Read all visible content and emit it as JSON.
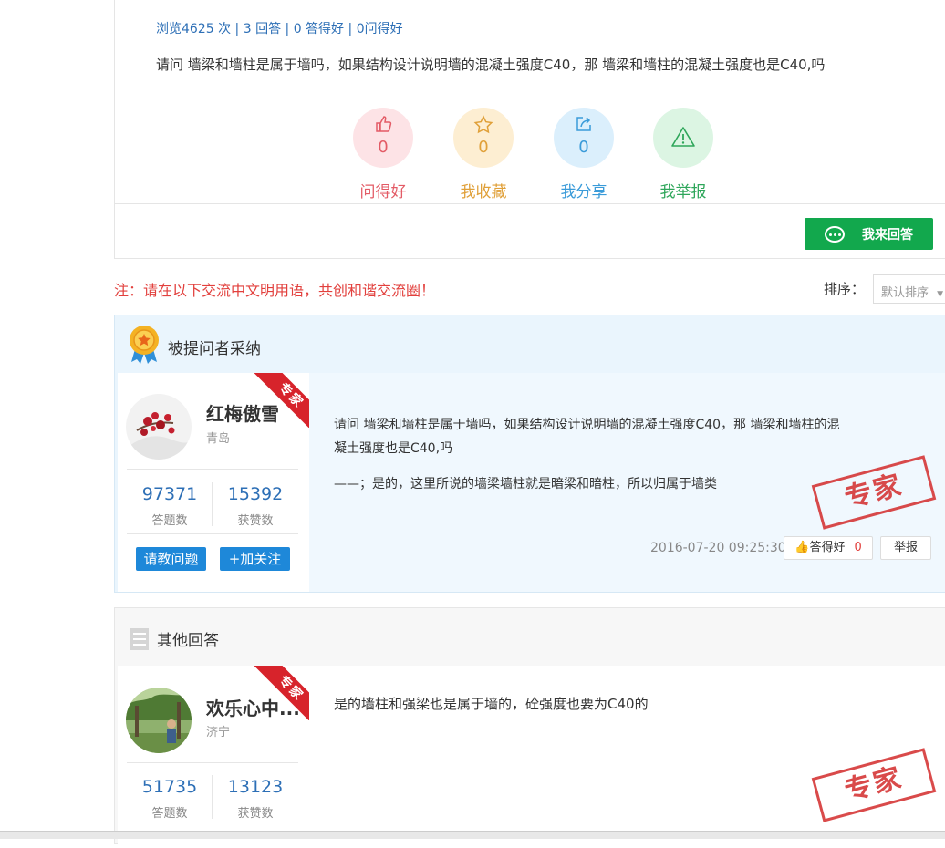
{
  "question": {
    "stats": {
      "views": "浏览4625 次",
      "answers": "3 回答",
      "good": "0 答得好",
      "asked_good": "0问得好",
      "sep": " | "
    },
    "text": "请问 墙梁和墙柱是属于墙吗，如果结构设计说明墙的混凝土强度C40，那 墙梁和墙柱的混凝土强度也是C40,吗",
    "actions": [
      {
        "label": "问得好",
        "count": "0",
        "icon": "thumbs-up-icon",
        "color": "#e35b66",
        "bg": "#fde3e6"
      },
      {
        "label": "我收藏",
        "count": "0",
        "icon": "star-icon",
        "color": "#e0a039",
        "bg": "#fdeed2"
      },
      {
        "label": "我分享",
        "count": "0",
        "icon": "share-icon",
        "color": "#3a9bd9",
        "bg": "#dbeffc"
      },
      {
        "label": "我举报",
        "count": "",
        "icon": "warning-icon",
        "color": "#2ea65a",
        "bg": "#dcf5e3"
      }
    ],
    "answer_button": "我来回答"
  },
  "notice": "注：请在以下交流中文明用语，共创和谐交流圈！",
  "sort": {
    "label": "排序：",
    "selected": "默认排序"
  },
  "accepted": {
    "header": "被提问者采纳",
    "user": {
      "name": "红梅傲雪",
      "location": "青岛",
      "answers_count": "97371",
      "answers_label": "答题数",
      "likes_count": "15392",
      "likes_label": "获赞数",
      "ask_button": "请教问题",
      "follow_button": "+加关注",
      "badge": "专家"
    },
    "answer_line1": "请问 墙梁和墙柱是属于墙吗，如果结构设计说明墙的混凝土强度C40，那 墙梁和墙柱的混",
    "answer_line2": "凝土强度也是C40,吗",
    "answer_reply": "——；是的，这里所说的墙梁墙柱就是暗梁和暗柱，所以归属于墙类",
    "stamp": "专家",
    "date": "2016-07-20 09:25:30",
    "good_button": "答得好",
    "good_count": "0",
    "report_button": "举报"
  },
  "others": {
    "header": "其他回答",
    "user": {
      "name": "欢乐心中...",
      "location": "济宁",
      "answers_count": "51735",
      "answers_label": "答题数",
      "likes_count": "13123",
      "likes_label": "获赞数",
      "badge": "专家"
    },
    "answer": "是的墙柱和强梁也是属于墙的，砼强度也要为C40的",
    "stamp": "专家"
  }
}
